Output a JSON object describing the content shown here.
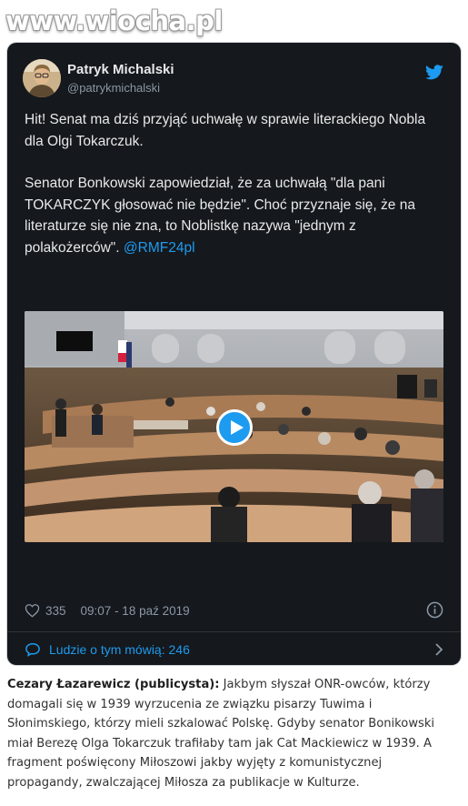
{
  "watermark": {
    "text": "www.wiocha.pl"
  },
  "tweet": {
    "author_name": "Patryk Michalski",
    "author_handle": "@patrykmichalski",
    "paragraph_1": "Hit! Senat ma dziś przyjąć uchwałę w sprawie literackiego Nobla dla Olgi Tokarczuk.",
    "paragraph_2": "Senator Bonkowski zapowiedział, że za uchwałą \"dla pani TOKARCZYK głosować nie będzie\". Choć przyznaje się, że na literaturze się nie zna, to Noblistkę nazywa \"jednym z polakożerców\".",
    "mention": "@RMF24pl",
    "likes": "335",
    "timestamp": "09:07 - 18 paź 2019",
    "people_talking": "Ludzie o tym mówią: 246",
    "colors": {
      "background": "#15181c",
      "accent": "#1d9bf0",
      "text": "#e7e9ea",
      "muted": "#8b98a5"
    },
    "icons": [
      "twitter-bird-icon",
      "play-icon",
      "heart-icon",
      "info-icon",
      "speech-bubble-icon",
      "chevron-right-icon"
    ]
  },
  "caption": {
    "author": "Cezary Łazarewicz (publicysta):",
    "text": "Jakbym słyszał ONR-owców, którzy domagali się w 1939 wyrzucenia ze związku pisarzy Tuwima i Słonimskiego, którzy mieli szkalować Polskę. Gdyby senator Bonikowski miał Berezę Olga Tokarczuk trafiłaby tam jak Cat Mackiewicz w 1939. A fragment poświęcony Miłoszowi jakby wyjęty z komunistycznej propagandy, zwalczającej Miłosza za publikacje w Kulturze."
  }
}
